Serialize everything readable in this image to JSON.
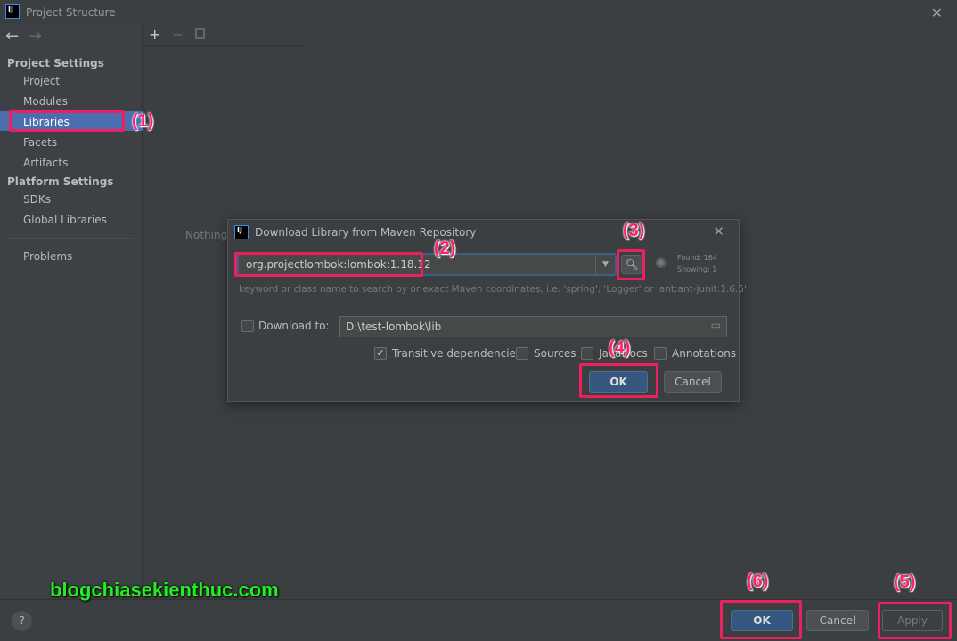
{
  "window": {
    "title": "Project Structure",
    "logo": "IJ"
  },
  "sidebar": {
    "project_settings": "Project Settings",
    "items": [
      "Project",
      "Modules",
      "Libraries",
      "Facets",
      "Artifacts"
    ],
    "platform_settings": "Platform Settings",
    "platform_items": [
      "SDKs",
      "Global Libraries"
    ],
    "problems": "Problems",
    "selected": "Libraries"
  },
  "middle": {
    "empty_text": "Nothing"
  },
  "dialog": {
    "title": "Download Library from Maven Repository",
    "search_value": "org.projectlombok:lombok:1.18.12",
    "found": "Found: 164",
    "showing": "Showing: 1",
    "hint": "keyword or class name to search by or exact Maven coordinates, i.e. 'spring', 'Logger' or 'ant:ant-junit:1.6.5'",
    "download_to_label": "Download to:",
    "download_to_checked": false,
    "download_path": "D:\\test-lombok\\lib",
    "options": [
      {
        "label": "Transitive dependencies",
        "checked": true
      },
      {
        "label": "Sources",
        "checked": false
      },
      {
        "label": "JavaDocs",
        "checked": false
      },
      {
        "label": "Annotations",
        "checked": false
      }
    ],
    "ok": "OK",
    "cancel": "Cancel"
  },
  "footer": {
    "help": "?",
    "ok": "OK",
    "cancel": "Cancel",
    "apply": "Apply"
  },
  "annotations": [
    "(1)",
    "(2)",
    "(3)",
    "(4)",
    "(5)",
    "(6)"
  ],
  "watermark": "blogchiasekienthuc.com",
  "colors": {
    "accent": "#4b6eaf",
    "primary_button": "#365880",
    "annotation": "#ee1f5f",
    "watermark": "#22ee22"
  }
}
